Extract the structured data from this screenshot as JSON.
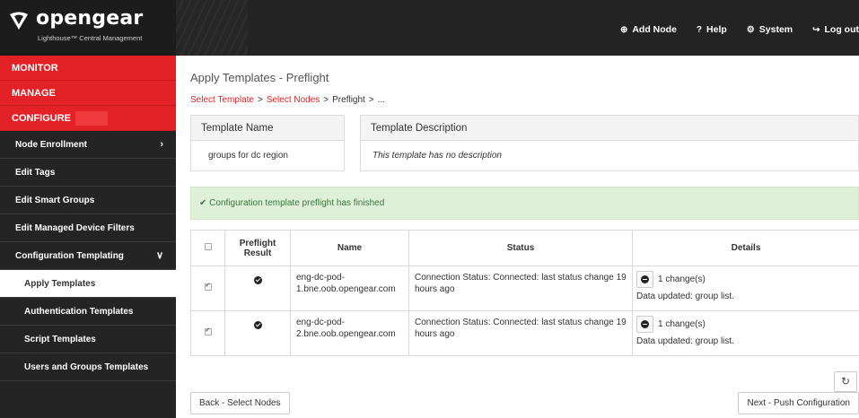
{
  "brand": {
    "name": "opengear",
    "subtitle": "Lighthouse™ Central Management"
  },
  "topnav": [
    {
      "icon": "plus-circle-icon",
      "glyph": "⊕",
      "label": "Add Node"
    },
    {
      "icon": "question-circle-icon",
      "glyph": "?",
      "label": "Help"
    },
    {
      "icon": "gear-icon",
      "glyph": "⚙",
      "label": "System"
    },
    {
      "icon": "logout-icon",
      "glyph": "↪",
      "label": "Log out"
    }
  ],
  "sidebar": {
    "sections": [
      "MONITOR",
      "MANAGE",
      "CONFIGURE"
    ],
    "items": [
      {
        "label": "Node Enrollment",
        "chevron": "›"
      },
      {
        "label": "Edit Tags"
      },
      {
        "label": "Edit Smart Groups"
      },
      {
        "label": "Edit Managed Device Filters"
      },
      {
        "label": "Configuration Templating",
        "chevron": "∨"
      }
    ],
    "subitems": [
      {
        "label": "Apply Templates",
        "active": true
      },
      {
        "label": "Authentication Templates"
      },
      {
        "label": "Script Templates"
      },
      {
        "label": "Users and Groups Templates"
      }
    ]
  },
  "page": {
    "title": "Apply Templates - Preflight",
    "breadcrumb": [
      "Select Template",
      "Select Nodes",
      "Preflight",
      "..."
    ],
    "breadcrumb_sep": ">"
  },
  "template": {
    "name_header": "Template Name",
    "name_value": "groups for dc region",
    "desc_header": "Template Description",
    "desc_value": "This template has no description"
  },
  "alert": {
    "icon": "check-icon",
    "text": "✔ Configuration template preflight has finished",
    "color": "#3c763d"
  },
  "table": {
    "headers": [
      "",
      "Preflight Result",
      "Name",
      "Status",
      "Details"
    ],
    "rows": [
      {
        "checked": true,
        "name": "eng-dc-pod-1.bne.oob.opengear.com",
        "status": "Connection Status: Connected: last status change 19 hours ago",
        "changes": "1 change(s)",
        "details": "Data updated: group list."
      },
      {
        "checked": true,
        "name": "eng-dc-pod-2.bne.oob.opengear.com",
        "status": "Connection Status: Connected: last status change 19 hours ago",
        "changes": "1 change(s)",
        "details": "Data updated: group list."
      }
    ]
  },
  "buttons": {
    "refresh_icon": "refresh-icon",
    "refresh_glyph": "↻",
    "back": "Back - Select Nodes",
    "next": "Next - Push Configuration"
  },
  "colors": {
    "accent": "#e32227",
    "sidebar": "#242424",
    "topbar": "#232323",
    "success_bg": "#dff0d8"
  }
}
